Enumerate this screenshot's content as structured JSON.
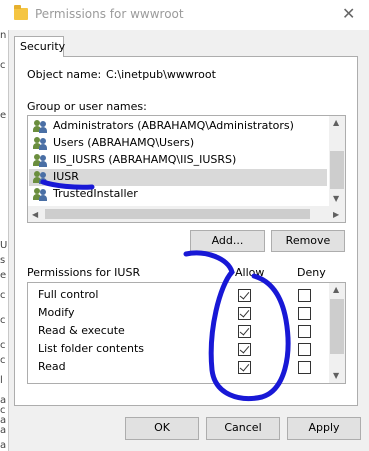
{
  "window": {
    "title": "Permissions for wwwroot"
  },
  "tabs": [
    {
      "label": "Security"
    }
  ],
  "object": {
    "label": "Object name:",
    "value": "C:\\inetpub\\wwwroot"
  },
  "group_label": "Group or user names:",
  "users": [
    {
      "name": "Administrators (ABRAHAMQ\\Administrators)"
    },
    {
      "name": "Users (ABRAHAMQ\\Users)"
    },
    {
      "name": "IIS_IUSRS (ABRAHAMQ\\IIS_IUSRS)"
    },
    {
      "name": "IUSR"
    },
    {
      "name": "TrustedInstaller"
    }
  ],
  "selected_user": "IUSR",
  "buttons": {
    "add": "Add...",
    "remove": "Remove",
    "ok": "OK",
    "cancel": "Cancel",
    "apply": "Apply"
  },
  "permissions": {
    "label": "Permissions for IUSR",
    "allow_header": "Allow",
    "deny_header": "Deny",
    "rows": [
      {
        "name": "Full control",
        "allow": true,
        "deny": false
      },
      {
        "name": "Modify",
        "allow": true,
        "deny": false
      },
      {
        "name": "Read & execute",
        "allow": true,
        "deny": false
      },
      {
        "name": "List folder contents",
        "allow": true,
        "deny": false
      },
      {
        "name": "Read",
        "allow": true,
        "deny": false
      }
    ]
  },
  "left_strip": [
    "n",
    "c",
    "e",
    "U",
    "s",
    "e",
    "c",
    "c",
    "c",
    "c",
    "l",
    "a",
    "c",
    "a",
    "a",
    "a"
  ],
  "colors": {
    "annotation": "#1818d6",
    "user_icon_a": "#6b8e3e",
    "user_icon_b": "#4a6fa5"
  }
}
